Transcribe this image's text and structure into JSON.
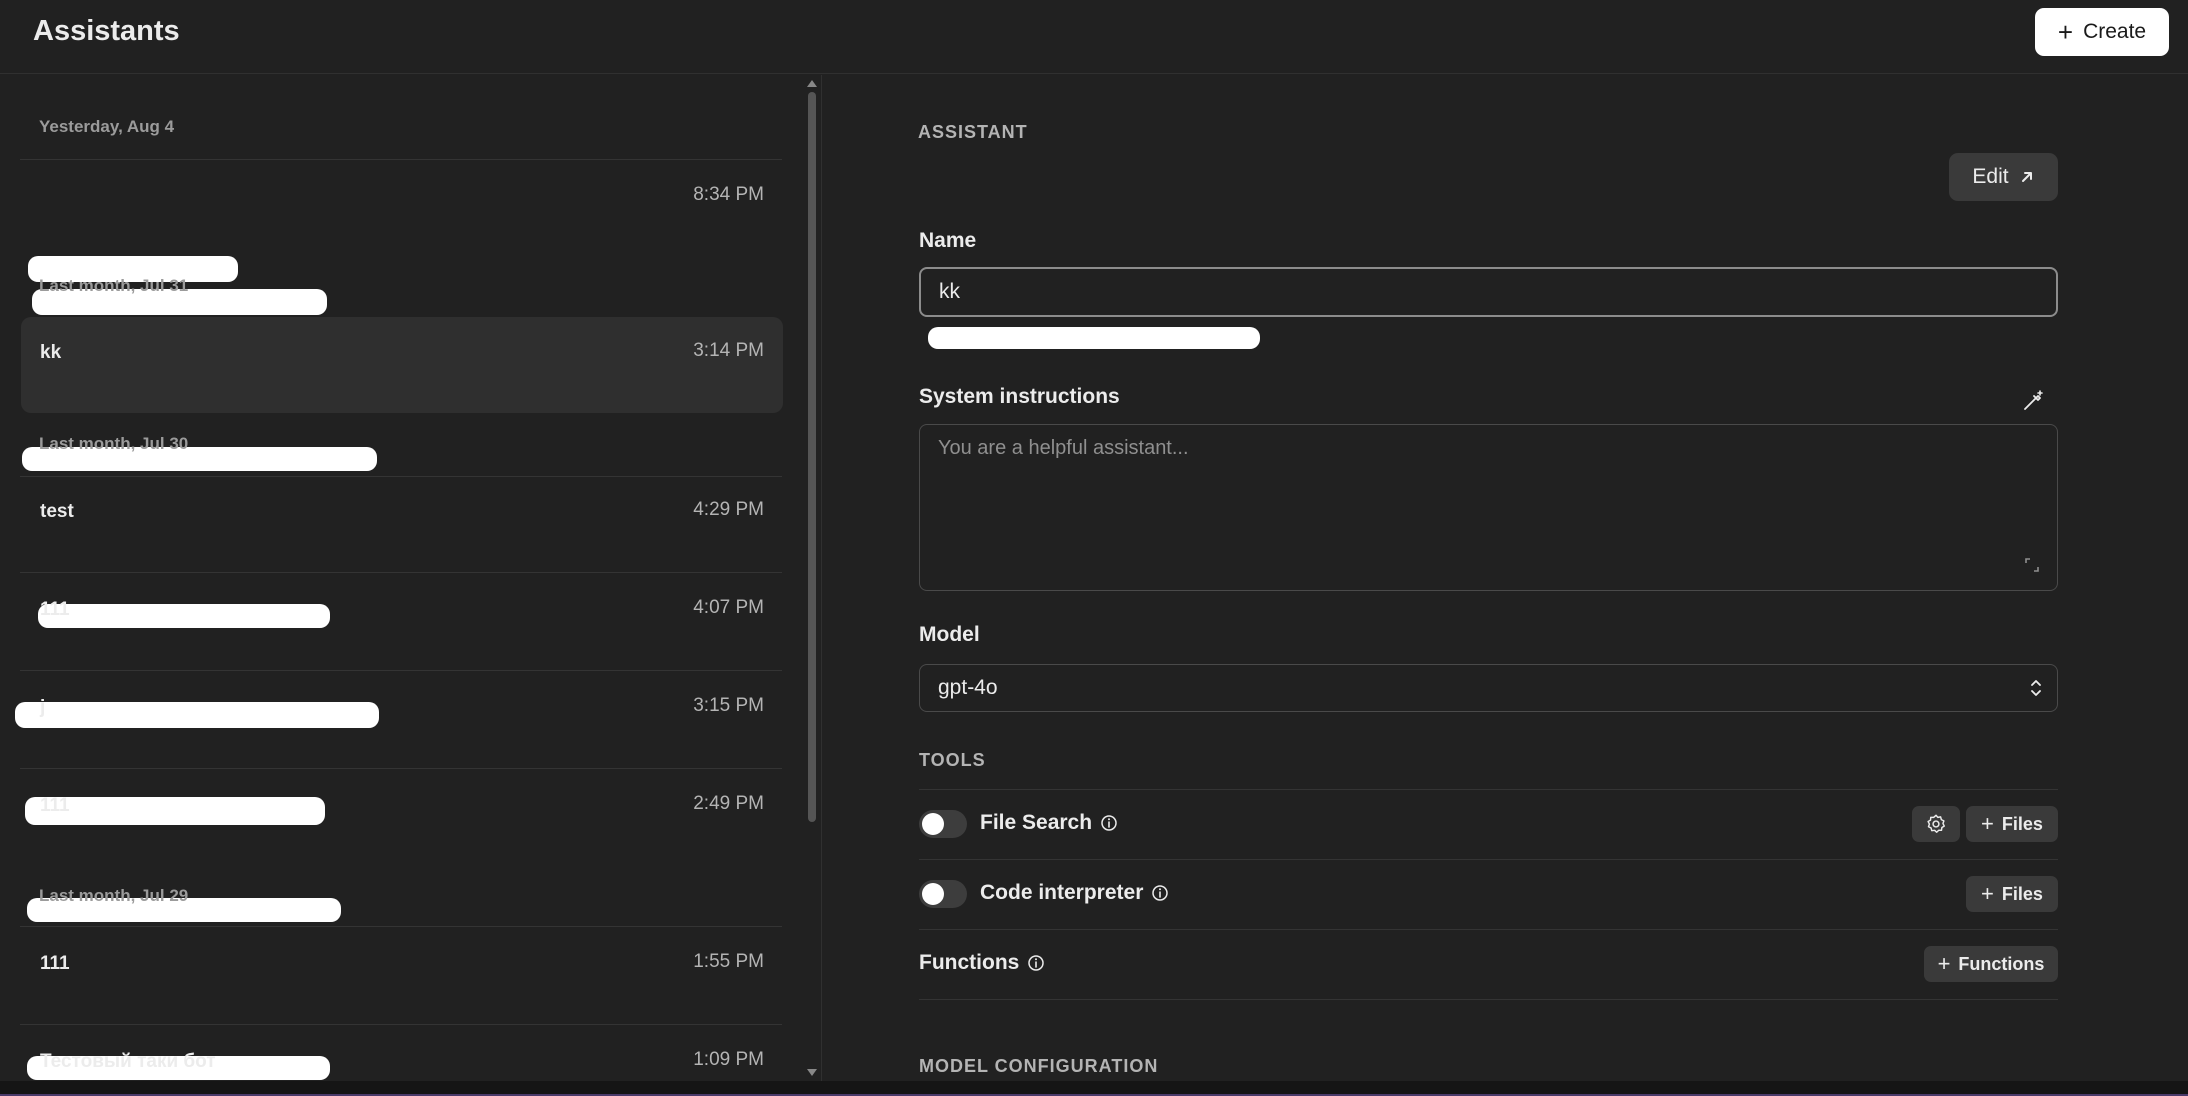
{
  "header": {
    "title": "Assistants",
    "create_label": "Create"
  },
  "list": {
    "groups": [
      {
        "label": "Yesterday, Aug 4",
        "items": [
          {
            "name": "",
            "time": "8:34 PM"
          }
        ]
      },
      {
        "label": "Last month, Jul 31",
        "items": [
          {
            "name": "kk",
            "time": "3:14 PM",
            "selected": true
          }
        ]
      },
      {
        "label": "Last month, Jul 30",
        "items": [
          {
            "name": "test",
            "time": "4:29 PM"
          },
          {
            "name": "111",
            "time": "4:07 PM"
          },
          {
            "name": "j",
            "time": "3:15 PM"
          },
          {
            "name": "111",
            "time": "2:49 PM"
          }
        ]
      },
      {
        "label": "Last month, Jul 29",
        "items": [
          {
            "name": "111",
            "time": "1:55 PM"
          },
          {
            "name": "Тестовый таки бот",
            "time": "1:09 PM"
          }
        ]
      }
    ]
  },
  "detail": {
    "section_label": "ASSISTANT",
    "edit_label": "Edit",
    "name_label": "Name",
    "name_value": "kk",
    "instructions_label": "System instructions",
    "instructions_placeholder": "You are a helpful assistant...",
    "model_label": "Model",
    "model_value": "gpt-4o",
    "tools_label": "TOOLS",
    "tools": {
      "file_search": {
        "label": "File Search",
        "enabled": false,
        "files_label": "Files"
      },
      "code_interpreter": {
        "label": "Code interpreter",
        "enabled": false,
        "files_label": "Files"
      },
      "functions": {
        "label": "Functions",
        "button_label": "Functions"
      }
    },
    "model_config_label": "MODEL CONFIGURATION"
  },
  "colors": {
    "background": "#212121",
    "text": "#ececec",
    "muted": "#9b9b9b",
    "selected_row": "#2f2f2f",
    "button_dark": "#3a3a3a",
    "button_light": "#ffffff"
  },
  "icons": [
    "plus-icon",
    "arrow-up-right-icon",
    "magic-wand-icon",
    "expand-icon",
    "chevrons-up-down-icon",
    "info-icon",
    "gear-icon"
  ]
}
